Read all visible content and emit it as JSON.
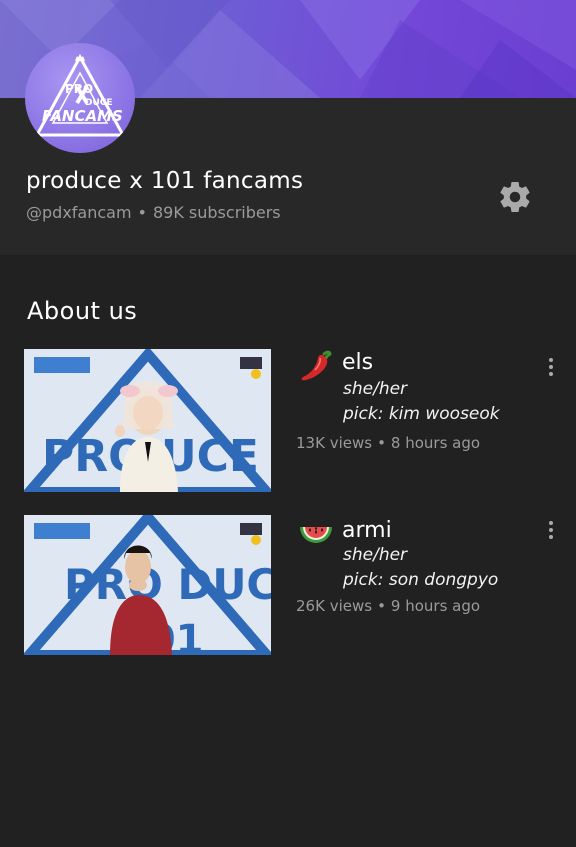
{
  "channel": {
    "name": "produce x 101 fancams",
    "handle": "@pdxfancam",
    "subscribers": "89K subscribers",
    "separator": "•",
    "logo_text_top": "PRO",
    "logo_text_mid": "DUCE",
    "logo_text_bottom": "FANCAMS"
  },
  "about": {
    "title": "About us"
  },
  "videos": [
    {
      "emoji_icon": "hot-pepper-icon",
      "title": "els",
      "line1": "she/her",
      "line2": "pick: kim wooseok",
      "views": "13K views",
      "age": "8 hours ago",
      "thumb_text": "PRO   UCE"
    },
    {
      "emoji_icon": "watermelon-icon",
      "title": "armi",
      "line1": "she/her",
      "line2": "pick: son dongpyo",
      "views": "26K views",
      "age": "9 hours ago",
      "thumb_text": "PRO   DUCE"
    }
  ],
  "colors": {
    "background": "#212121",
    "header": "#282828",
    "banner": "#6d5fd4",
    "secondary_text": "#9a9a9a"
  }
}
